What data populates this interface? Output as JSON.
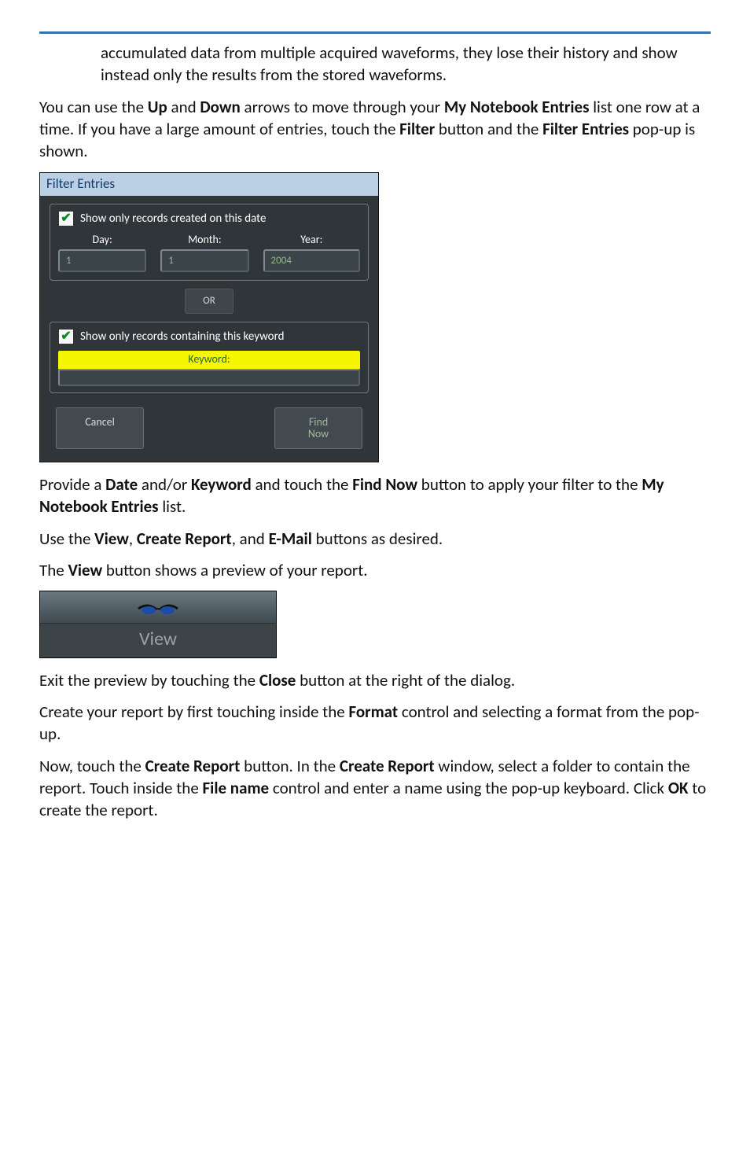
{
  "doc": {
    "indent_para": "accumulated data from multiple acquired waveforms, they lose their history and show instead only the results from the stored waveforms.",
    "p1_a": "You can use the ",
    "p1_b": "Up",
    "p1_c": " and ",
    "p1_d": "Down",
    "p1_e": " arrows to move through your ",
    "p1_f": "My Notebook Entries",
    "p1_g": " list one row at a time. If you have a large amount of entries, touch the ",
    "p1_h": "Filter",
    "p1_i": " button and the ",
    "p1_j": "Filter Entries",
    "p1_k": " pop-up is shown.",
    "p2_a": "Provide a ",
    "p2_b": "Date",
    "p2_c": " and/or ",
    "p2_d": "Keyword",
    "p2_e": " and touch the ",
    "p2_f": "Find Now",
    "p2_g": " button to apply your filter to the ",
    "p2_h": "My Notebook Entries",
    "p2_i": " list.",
    "p3_a": "Use the ",
    "p3_b": "View",
    "p3_c": ", ",
    "p3_d": "Create Report",
    "p3_e": ", and ",
    "p3_f": "E-Mail",
    "p3_g": " buttons as desired.",
    "p4_a": "The ",
    "p4_b": "View",
    "p4_c": " button shows a preview of your report.",
    "p5_a": "Exit the preview by touching the ",
    "p5_b": "Close",
    "p5_c": " button at the right of the dialog.",
    "p6_a": "Create your report by first touching inside the ",
    "p6_b": "Format",
    "p6_c": " control and selecting a format from the pop-up.",
    "p7_a": "Now, touch the ",
    "p7_b": "Create Report",
    "p7_c": " button. In the ",
    "p7_d": "Create Report",
    "p7_e": " window, select a folder to contain the report. Touch inside the ",
    "p7_f": "File name",
    "p7_g": " control and enter a name using the pop-up keyboard. Click ",
    "p7_h": "OK",
    "p7_i": " to create the report."
  },
  "filter_dialog": {
    "title": "Filter Entries",
    "chk_date": "Show only records created on this date",
    "day_label": "Day:",
    "month_label": "Month:",
    "year_label": "Year:",
    "day_value": "1",
    "month_value": "1",
    "year_value": "2004",
    "or_label": "OR",
    "chk_keyword": "Show only records containing this keyword",
    "keyword_label": "Keyword:",
    "keyword_value": "",
    "cancel": "Cancel",
    "find_now": "Find\nNow"
  },
  "view_button": {
    "label": "View"
  }
}
